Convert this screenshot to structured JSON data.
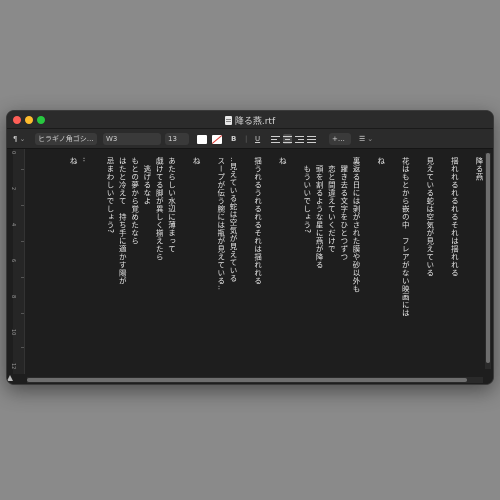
{
  "window": {
    "title": "降る燕.rtf"
  },
  "toolbar": {
    "paragraph_symbol": "¶",
    "font_family": "ヒラギノ角ゴシ…",
    "font_style": "W3",
    "font_size": "13",
    "bold": "B",
    "underline": "U",
    "spacing": "+…",
    "list": "☰"
  },
  "ruler": {
    "numbers": [
      "0",
      "2",
      "4",
      "6",
      "8",
      "10",
      "12"
    ]
  },
  "document": {
    "columns": [
      "降る燕",
      "",
      "揺れれるれるれるそれは揺れれる",
      "",
      "見えている蛇は空気が見えている",
      "",
      "花はもとから嵌の中　フレアがない映画には",
      "",
      "ね",
      "",
      "裏返る日には剥がされた膜や砂以外も",
      "　躍き去る文字をひとつずつ",
      "　恋と間違えていくだけで",
      "　頭を割るような星に燕が降る",
      "　もういいでしょう?",
      "",
      "ね",
      "",
      "揺うれるうれるれるそれは揺れれる",
      "",
      "‥見えている蛇は空気が見えている",
      "スープが伝う腕には瓶が見えている‥",
      "",
      "ね",
      "",
      "あたらしい水辺に薄まって",
      "戯けてる脚が異しく揃えたら",
      "　逃げるなよ",
      "もとの夢から覚めたなら",
      "はたと冷えて　持ち手に適かす陽が",
      "忌まわしいでしょう?",
      "",
      "‥",
      "ね"
    ]
  },
  "colors": {
    "page_background": "#1e1e1e",
    "text": "#e8e8e8",
    "close": "#ff5f57",
    "minimize": "#febc2e",
    "maximize": "#28c840"
  }
}
